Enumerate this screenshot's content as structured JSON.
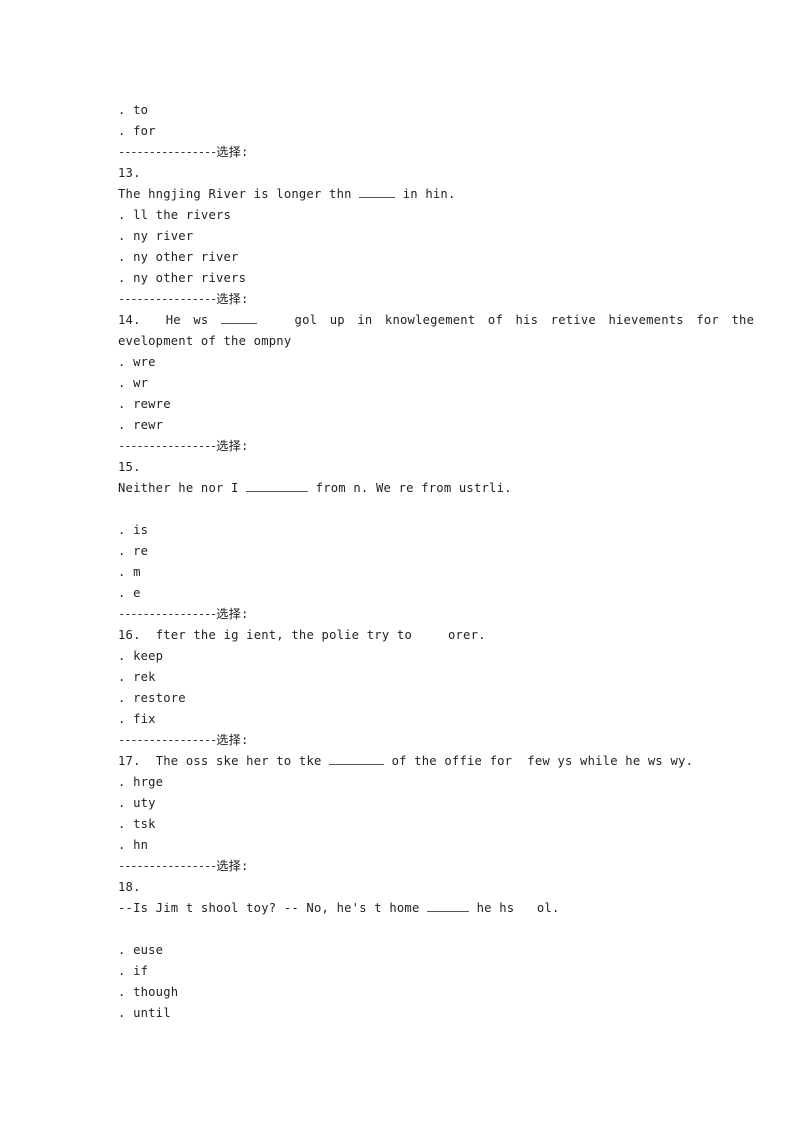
{
  "sep_dashes": "----------------",
  "sep_label": "选择:",
  "top_options": [
    ". to",
    ". for"
  ],
  "questions": [
    {
      "number": "13.",
      "stem_before": "The hngjing River is longer thn ",
      "stem_after": " in hin.",
      "options": [
        ". ll the rivers",
        ". ny river",
        ". ny other river",
        ". ny other rivers"
      ]
    },
    {
      "number": "14.",
      "stem_before": "He ws ",
      "stem_after": " gol up in knowlegement of his retive hievements for the",
      "stem_line2": "evelopment of the ompny",
      "options": [
        ". wre",
        ". wr",
        ". rewre",
        ". rewr"
      ]
    },
    {
      "number": "15.",
      "stem_before": "Neither he nor I ",
      "stem_after": " from n. We re from ustrli.",
      "options": [
        ". is",
        ". re",
        ". m",
        ". e"
      ]
    },
    {
      "number": "16.",
      "stem_before": "fter the ig ient, the polie try to",
      "stem_after": "orer.",
      "options": [
        ". keep",
        ". rek",
        ". restore",
        ". fix"
      ]
    },
    {
      "number": "17.",
      "stem_before": "The oss ske her to tke ",
      "stem_after": " of the offie for  few ys while he ws wy.",
      "options": [
        ". hrge",
        ". uty",
        ". tsk",
        ". hn"
      ]
    },
    {
      "number": "18.",
      "stem_before": "--Is Jim t shool toy? -- No, he's t home ",
      "stem_after": " he hs   ol.",
      "options": [
        ". euse",
        ". if",
        ". though",
        ". until"
      ]
    }
  ]
}
